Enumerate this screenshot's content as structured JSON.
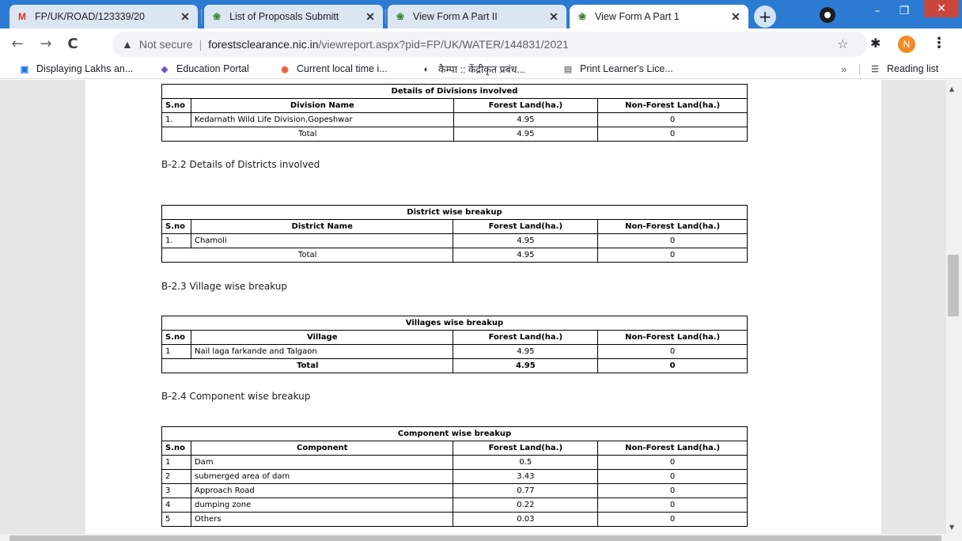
{
  "browser": {
    "tabs": [
      {
        "title": "FP/UK/ROAD/123339/20",
        "favicon": "gmail-icon"
      },
      {
        "title": "List of Proposals Submitt",
        "favicon": "forest-icon"
      },
      {
        "title": "View Form A Part II",
        "favicon": "forest-icon"
      },
      {
        "title": "View Form A Part 1",
        "favicon": "forest-icon"
      }
    ],
    "newtab_label": "+",
    "close_glyph": "✕",
    "window": {
      "minimize": "–",
      "restore": "❐",
      "close": "✕"
    },
    "omnibox": {
      "security": "Not secure",
      "host": "forestsclearance.nic.in",
      "path": "/viewreport.aspx?pid=FP/UK/WATER/144831/2021"
    },
    "avatar_letter": "N",
    "bookmarks": [
      {
        "label": "Displaying Lakhs an...",
        "icon": "slides-icon"
      },
      {
        "label": "Education Portal",
        "icon": "education-icon"
      },
      {
        "label": "Current local time i...",
        "icon": "clock-icon"
      },
      {
        "label": "कैम्पा :: केंद्रीकृत प्रबंध...",
        "icon": "globe-icon"
      },
      {
        "label": "Print Learner's Lice...",
        "icon": "license-icon"
      }
    ],
    "bookmarks_more": "»",
    "reading_list": "Reading list",
    "accent_color": "#2b7bd3"
  },
  "report": {
    "divisions": {
      "caption": "Details of Divisions involved",
      "headers": [
        "S.no",
        "Division Name",
        "Forest Land(ha.)",
        "Non-Forest Land(ha.)"
      ],
      "rows": [
        [
          "1.",
          "Kedarnath Wild Life Division,Gopeshwar",
          "4.95",
          "0"
        ]
      ],
      "total": [
        "Total",
        "4.95",
        "0"
      ]
    },
    "districts_heading": "B-2.2 Details of Districts involved",
    "districts": {
      "caption": "District wise breakup",
      "headers": [
        "S.no",
        "District Name",
        "Forest Land(ha.)",
        "Non-Forest Land(ha.)"
      ],
      "rows": [
        [
          "1.",
          "Chamoli",
          "4.95",
          "0"
        ]
      ],
      "total": [
        "Total",
        "4.95",
        "0"
      ]
    },
    "villages_heading": "B-2.3 Village wise breakup",
    "villages": {
      "caption": "Villages wise breakup",
      "headers": [
        "S.no",
        "Village",
        "Forest Land(ha.)",
        "Non-Forest Land(ha.)"
      ],
      "rows": [
        [
          "1",
          "Nail laga farkande and Talgaon",
          "4.95",
          "0"
        ]
      ],
      "total": [
        "Total",
        "4.95",
        "0"
      ]
    },
    "components_heading": "B-2.4 Component wise breakup",
    "components": {
      "caption": "Component wise breakup",
      "headers": [
        "S.no",
        "Component",
        "Forest Land(ha.)",
        "Non-Forest Land(ha.)"
      ],
      "rows": [
        [
          "1",
          "Dam",
          "0.5",
          "0"
        ],
        [
          "2",
          "submerged area of dam",
          "3.43",
          "0"
        ],
        [
          "3",
          "Approach Road",
          "0.77",
          "0"
        ],
        [
          "4",
          "dumping zone",
          "0.22",
          "0"
        ],
        [
          "5",
          "Others",
          "0.03",
          "0"
        ]
      ]
    }
  }
}
